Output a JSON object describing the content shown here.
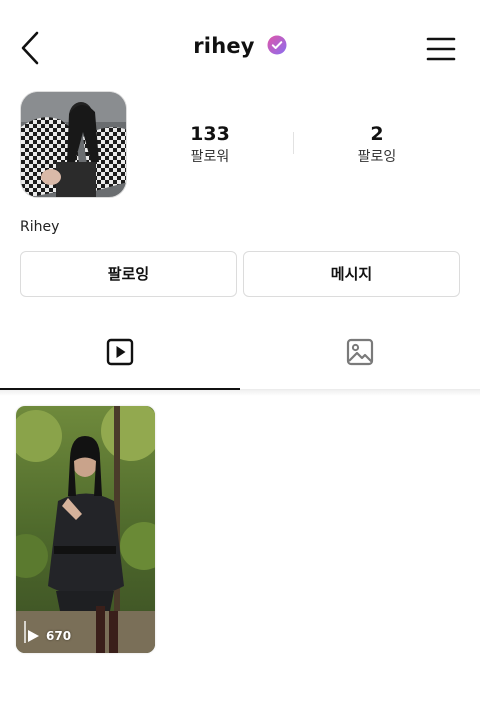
{
  "header": {
    "title": "rihey",
    "verified_badge_color": "#c061e0",
    "icons": {
      "back": "chevron-left-icon",
      "menu": "hamburger-menu-icon",
      "verified": "verified-badge-icon"
    }
  },
  "profile": {
    "display_name": "Rihey",
    "stats": [
      {
        "value": "133",
        "label": "팔로워"
      },
      {
        "value": "2",
        "label": "팔로잉"
      }
    ]
  },
  "actions": {
    "follow_label": "팔로잉",
    "message_label": "메시지"
  },
  "tabs": [
    {
      "icon": "video-play-icon",
      "active": true
    },
    {
      "icon": "image-gallery-icon",
      "active": false
    }
  ],
  "videos": [
    {
      "view_count": "670",
      "icon": "play-icon"
    }
  ]
}
